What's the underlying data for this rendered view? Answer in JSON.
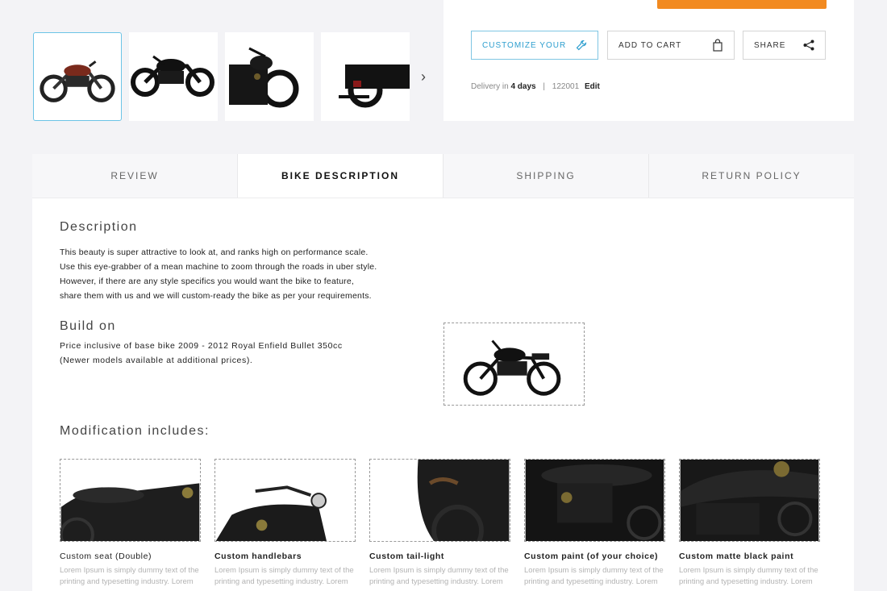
{
  "thumbnails": [
    {
      "name": "thumbnail-bike-red",
      "tone": "#7a2a1c"
    },
    {
      "name": "thumbnail-bike-black-side",
      "tone": "#111111"
    },
    {
      "name": "thumbnail-bike-black-front",
      "tone": "#1a1a1a"
    },
    {
      "name": "thumbnail-bike-black-rear",
      "tone": "#121212"
    }
  ],
  "actions": {
    "customize": "CUSTOMIZE YOUR",
    "add_to_cart": "ADD TO CART",
    "share": "SHARE"
  },
  "delivery": {
    "prefix": "Delivery in",
    "days": "4 days",
    "separator": "|",
    "pincode": "122001",
    "edit": "Edit"
  },
  "tabs": [
    "REVIEW",
    "BIKE DESCRIPTION",
    "SHIPPING",
    "RETURN POLICY"
  ],
  "description": {
    "title": "Description",
    "lines": [
      "This beauty is super attractive to look at, and ranks high on performance scale.",
      "Use this eye-grabber of a mean machine to zoom through the roads in uber style.",
      "However, if there are any style specifics you would want the bike to feature,",
      "share them with us and we will custom-ready the bike as per your requirements."
    ]
  },
  "build": {
    "title": "Build on",
    "line1": "Price inclusive of base bike 2009 - 2012 Royal Enfield Bullet 350cc",
    "line2": "(Newer models available at additional prices)."
  },
  "modifications": {
    "title": "Modification includes:",
    "items": [
      {
        "title": "Custom seat (Double)",
        "desc1": "Lorem Ipsum is simply dummy text of the",
        "desc2": "printing and typesetting industry. Lorem"
      },
      {
        "title": "Custom handlebars",
        "desc1": "Lorem Ipsum is simply dummy text of the",
        "desc2": "printing and typesetting industry. Lorem"
      },
      {
        "title": "Custom tail-light",
        "desc1": "Lorem Ipsum is simply dummy text of the",
        "desc2": "printing and typesetting industry. Lorem"
      },
      {
        "title": "Custom paint (of your choice)",
        "desc1": "Lorem Ipsum is simply dummy text of the",
        "desc2": "printing and typesetting industry. Lorem"
      },
      {
        "title": "Custom matte black paint",
        "desc1": "Lorem Ipsum is simply dummy text of the",
        "desc2": "printing and typesetting industry. Lorem"
      }
    ]
  },
  "colors": {
    "accent": "#2e9fcf",
    "cta": "#f28a20",
    "active_thumb_border": "#6cc4e6"
  }
}
